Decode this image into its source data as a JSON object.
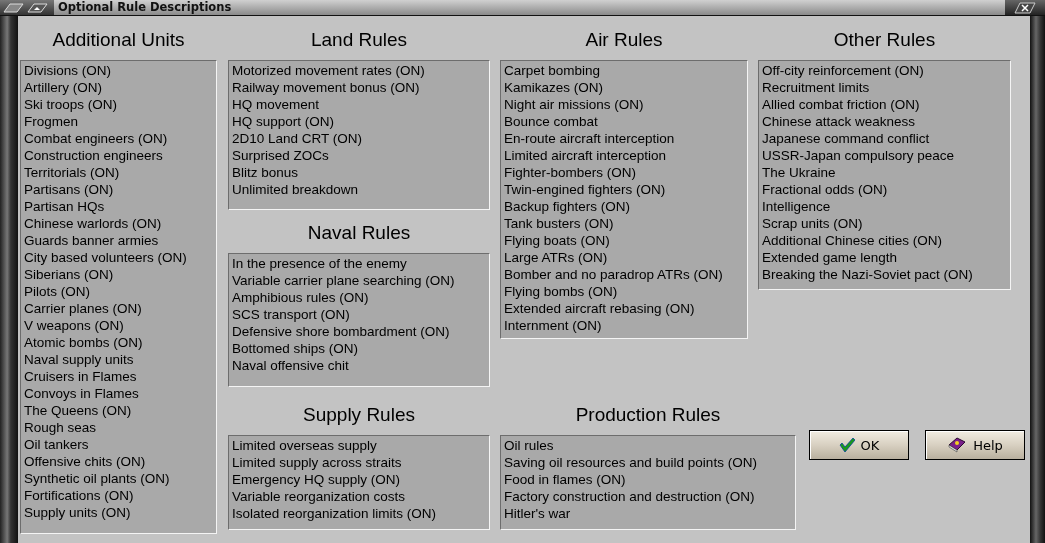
{
  "window": {
    "title": "Optional Rule Descriptions"
  },
  "sections": [
    {
      "heading": "Additional Units",
      "items": [
        "Divisions (ON)",
        "Artillery (ON)",
        "Ski troops (ON)",
        "Frogmen",
        "Combat engineers (ON)",
        "Construction engineers",
        "Territorials (ON)",
        "Partisans (ON)",
        "Partisan HQs",
        "Chinese warlords (ON)",
        "Guards banner armies",
        "City based volunteers (ON)",
        "Siberians (ON)",
        "Pilots (ON)",
        "Carrier planes (ON)",
        "V weapons (ON)",
        "Atomic bombs (ON)",
        "Naval supply units",
        "Cruisers in Flames",
        "Convoys in Flames",
        "The Queens (ON)",
        "Rough seas",
        "Oil tankers",
        "Offensive chits (ON)",
        "Synthetic oil plants (ON)",
        "Fortifications (ON)",
        "Supply units (ON)"
      ]
    },
    {
      "heading": "Land Rules",
      "items": [
        "Motorized movement rates (ON)",
        "Railway movement bonus (ON)",
        "HQ movement",
        "HQ support (ON)",
        "2D10 Land CRT (ON)",
        "Surprised ZOCs",
        "Blitz bonus",
        "Unlimited breakdown"
      ]
    },
    {
      "heading": "Air Rules",
      "items": [
        "Carpet bombing",
        "Kamikazes (ON)",
        "Night air missions (ON)",
        "Bounce combat",
        "En-route aircraft interception",
        "Limited aircraft interception",
        "Fighter-bombers (ON)",
        "Twin-engined fighters (ON)",
        "Backup fighters (ON)",
        "Tank busters (ON)",
        "Flying boats (ON)",
        "Large ATRs (ON)",
        "Bomber and no paradrop ATRs (ON)",
        "Flying bombs (ON)",
        "Extended aircraft rebasing (ON)",
        "Internment (ON)"
      ]
    },
    {
      "heading": "Other Rules",
      "items": [
        "Off-city reinforcement (ON)",
        "Recruitment limits",
        "Allied combat friction (ON)",
        "Chinese attack weakness",
        "Japanese command conflict",
        "USSR-Japan compulsory peace",
        "The Ukraine",
        "Fractional odds (ON)",
        "Intelligence",
        "Scrap units (ON)",
        "Additional Chinese cities (ON)",
        "Extended game length",
        "Breaking the Nazi-Soviet pact (ON)"
      ]
    },
    {
      "heading": "Naval Rules",
      "items": [
        "In the presence of the enemy",
        "Variable carrier plane searching (ON)",
        "Amphibious rules (ON)",
        "SCS transport (ON)",
        "Defensive shore bombardment (ON)",
        "Bottomed ships (ON)",
        "Naval offensive chit"
      ]
    },
    {
      "heading": "Supply Rules",
      "items": [
        "Limited overseas supply",
        "Limited supply across straits",
        "Emergency HQ supply (ON)",
        "Variable reorganization costs",
        "Isolated reorganization limits (ON)"
      ]
    },
    {
      "heading": "Production Rules",
      "items": [
        "Oil rules",
        "Saving oil resources and build points (ON)",
        "Food in flames (ON)",
        "Factory construction and destruction (ON)",
        "Hitler's war"
      ]
    }
  ],
  "buttons": [
    {
      "label": "OK",
      "kind": "ok"
    },
    {
      "label": "Help",
      "kind": "help"
    }
  ]
}
